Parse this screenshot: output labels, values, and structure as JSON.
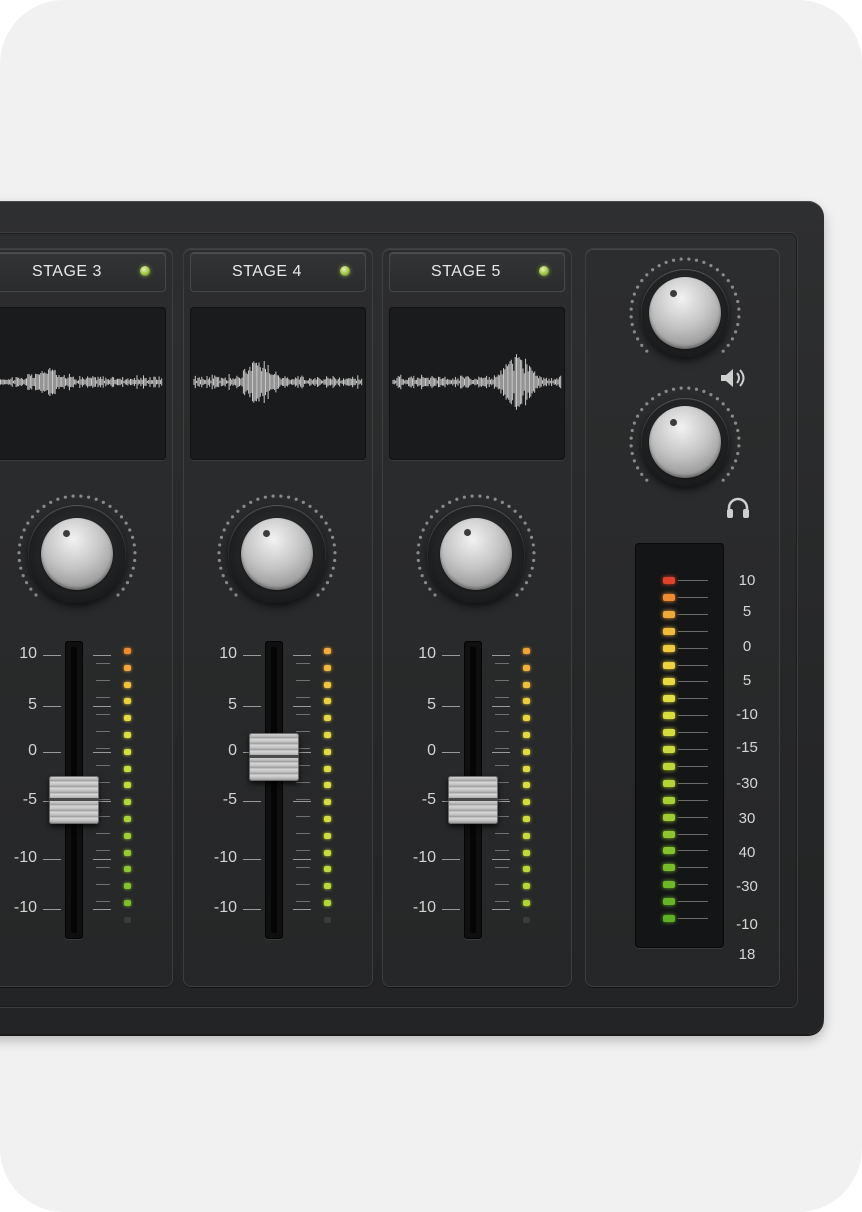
{
  "mixer": {
    "channels": [
      {
        "id": "stage3",
        "name": "STAGE 3",
        "led_color": "#9bbf40",
        "fader_scale": [
          "10",
          "5",
          "0",
          "-5",
          "-10",
          "-10"
        ],
        "meter_colors": [
          "#f08a2a",
          "#f4a636",
          "#f2c13b",
          "#e9d23f",
          "#e3dc40",
          "#d9df3f",
          "#d3e13e",
          "#c7df3c",
          "#bfdd3a",
          "#b3d839",
          "#a9d336",
          "#9fcf33",
          "#96ca30",
          "#8ec62e",
          "#86c22c",
          "#7ebe2a",
          "#3b3b3b"
        ]
      },
      {
        "id": "stage4",
        "name": "STAGE 4",
        "led_color": "#9bbf40",
        "fader_scale": [
          "10",
          "5",
          "0",
          "-5",
          "-10",
          "-10"
        ],
        "meter_colors": [
          "#f5a939",
          "#f3b83b",
          "#f0c63d",
          "#ebd13f",
          "#e8d640",
          "#e4d941",
          "#e1dc41",
          "#dede41",
          "#dade40",
          "#d6de3f",
          "#d1de3e",
          "#cbdd3c",
          "#c5dc3a",
          "#bfdb38",
          "#b9d936",
          "#b3d734",
          "#3b3b3b"
        ]
      },
      {
        "id": "stage5",
        "name": "STAGE 5",
        "led_color": "#9bbf40",
        "fader_scale": [
          "10",
          "5",
          "0",
          "-5",
          "-10",
          "-10"
        ],
        "meter_colors": [
          "#f2a236",
          "#f2b23a",
          "#efc03c",
          "#ebcc3e",
          "#e8d43f",
          "#e4d940",
          "#e0dc41",
          "#dcdd40",
          "#d8dd3f",
          "#d3dc3e",
          "#cedc3d",
          "#c8db3b",
          "#c2da39",
          "#bcd837",
          "#b6d635",
          "#b0d433",
          "#3b3b3b"
        ]
      }
    ],
    "master": {
      "knob_icons": [
        "speaker-icon",
        "headphones-icon"
      ],
      "meter_scale": [
        "10",
        "5",
        "0",
        "5",
        "-10",
        "-15",
        "-30",
        "30",
        "40",
        "-30",
        "-10",
        "18"
      ],
      "meter_colors": [
        "#e0432c",
        "#ef8a2f",
        "#f0a83a",
        "#f1bc3c",
        "#efc93d",
        "#ecd33f",
        "#e7d940",
        "#e1dc40",
        "#dbdd3f",
        "#d4dc3e",
        "#cbda3c",
        "#c0d739",
        "#b4d336",
        "#a8cf33",
        "#9dcb30",
        "#90c62d",
        "#84c12b",
        "#78bc29",
        "#6eb827",
        "#65b425",
        "#5cb023"
      ]
    }
  }
}
